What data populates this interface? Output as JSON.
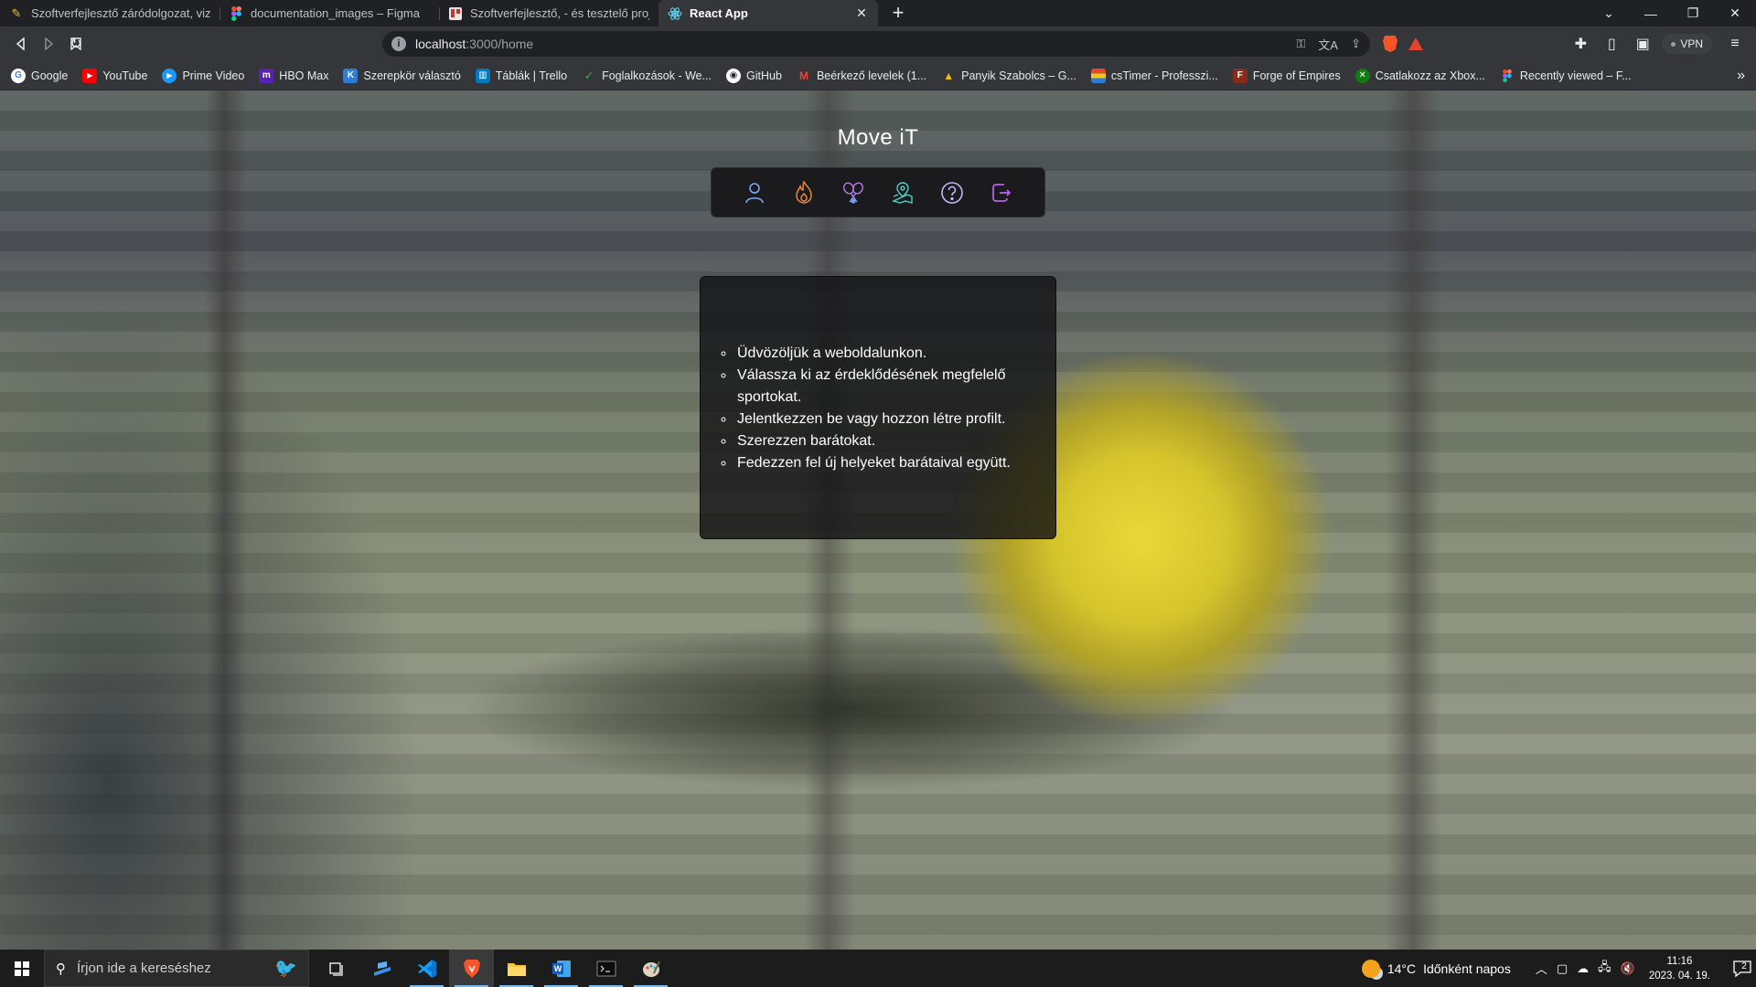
{
  "browser": {
    "tabs": [
      {
        "title": "Szoftverfejlesztő záródolgozat, vizsga",
        "icon": "pencil-doc-icon",
        "color": "#f6c12a"
      },
      {
        "title": "documentation_images – Figma",
        "icon": "figma-icon",
        "color": "#f24e1e"
      },
      {
        "title": "Szoftverfejlesztő, - és tesztelő projekt",
        "icon": "trello-icon",
        "color": "#e8e8e8"
      },
      {
        "title": "React App",
        "icon": "react-icon",
        "color": "#61dafb"
      }
    ],
    "new_tab_label": "+",
    "address": {
      "host": "localhost",
      "path": ":3000/home"
    },
    "vpn_label": "VPN",
    "bookmarks": [
      {
        "label": "Google",
        "icon": "google-icon",
        "color": "#4285f4"
      },
      {
        "label": "YouTube",
        "icon": "youtube-icon",
        "color": "#ff0000"
      },
      {
        "label": "Prime Video",
        "icon": "prime-video-icon",
        "color": "#1a98ff"
      },
      {
        "label": "HBO Max",
        "icon": "hbo-max-icon",
        "color": "#5822b4"
      },
      {
        "label": "Szerepkör választó",
        "icon": "k-logo-icon",
        "color": "#2d7dd2"
      },
      {
        "label": "Táblák | Trello",
        "icon": "trello-icon",
        "color": "#0079bf"
      },
      {
        "label": "Foglalkozások - We...",
        "icon": "check-logo-icon",
        "color": "#2fb344"
      },
      {
        "label": "GitHub",
        "icon": "github-icon",
        "color": "#ffffff"
      },
      {
        "label": "Beérkező levelek (1...",
        "icon": "gmail-icon",
        "color": "#ea4335"
      },
      {
        "label": "Panyik Szabolcs – G...",
        "icon": "google-drive-icon",
        "color": "#fbbc04"
      },
      {
        "label": "csTimer - Professzi...",
        "icon": "cstimer-icon",
        "color": "#e04b2c"
      },
      {
        "label": "Forge of Empires",
        "icon": "forge-of-empires-icon",
        "color": "#c0392b"
      },
      {
        "label": "Csatlakozz az Xbox...",
        "icon": "xbox-icon",
        "color": "#107c10"
      },
      {
        "label": "Recently viewed – F...",
        "icon": "figma-icon",
        "color": "#f24e1e"
      }
    ]
  },
  "app": {
    "title": "Move iT",
    "nav": [
      {
        "name": "profile",
        "icon": "user-icon",
        "color": "#7aa7ff"
      },
      {
        "name": "sports",
        "icon": "fire-icon",
        "color": "#f0873a"
      },
      {
        "name": "friends",
        "icon": "badminton-icon",
        "color": "#b07cf0"
      },
      {
        "name": "places",
        "icon": "map-location-icon",
        "color": "#4fd1c5"
      },
      {
        "name": "help",
        "icon": "help-circle-icon",
        "color": "#c6b6ff"
      },
      {
        "name": "logout",
        "icon": "logout-icon",
        "color": "#c15bff"
      }
    ],
    "welcome_items": [
      "Üdvözöljük a weboldalunkon.",
      "Válassza ki az érdeklődésének megfelelő sportokat.",
      "Jelentkezzen be vagy hozzon létre profilt.",
      "Szerezzen barátokat.",
      "Fedezzen fel új helyeket barátaival együtt."
    ]
  },
  "taskbar": {
    "search_placeholder": "Írjon ide a kereséshez",
    "weather_temp": "14°C",
    "weather_text": "Időnként napos",
    "time": "11:16",
    "date": "2023. 04. 19.",
    "notification_count": "2"
  }
}
